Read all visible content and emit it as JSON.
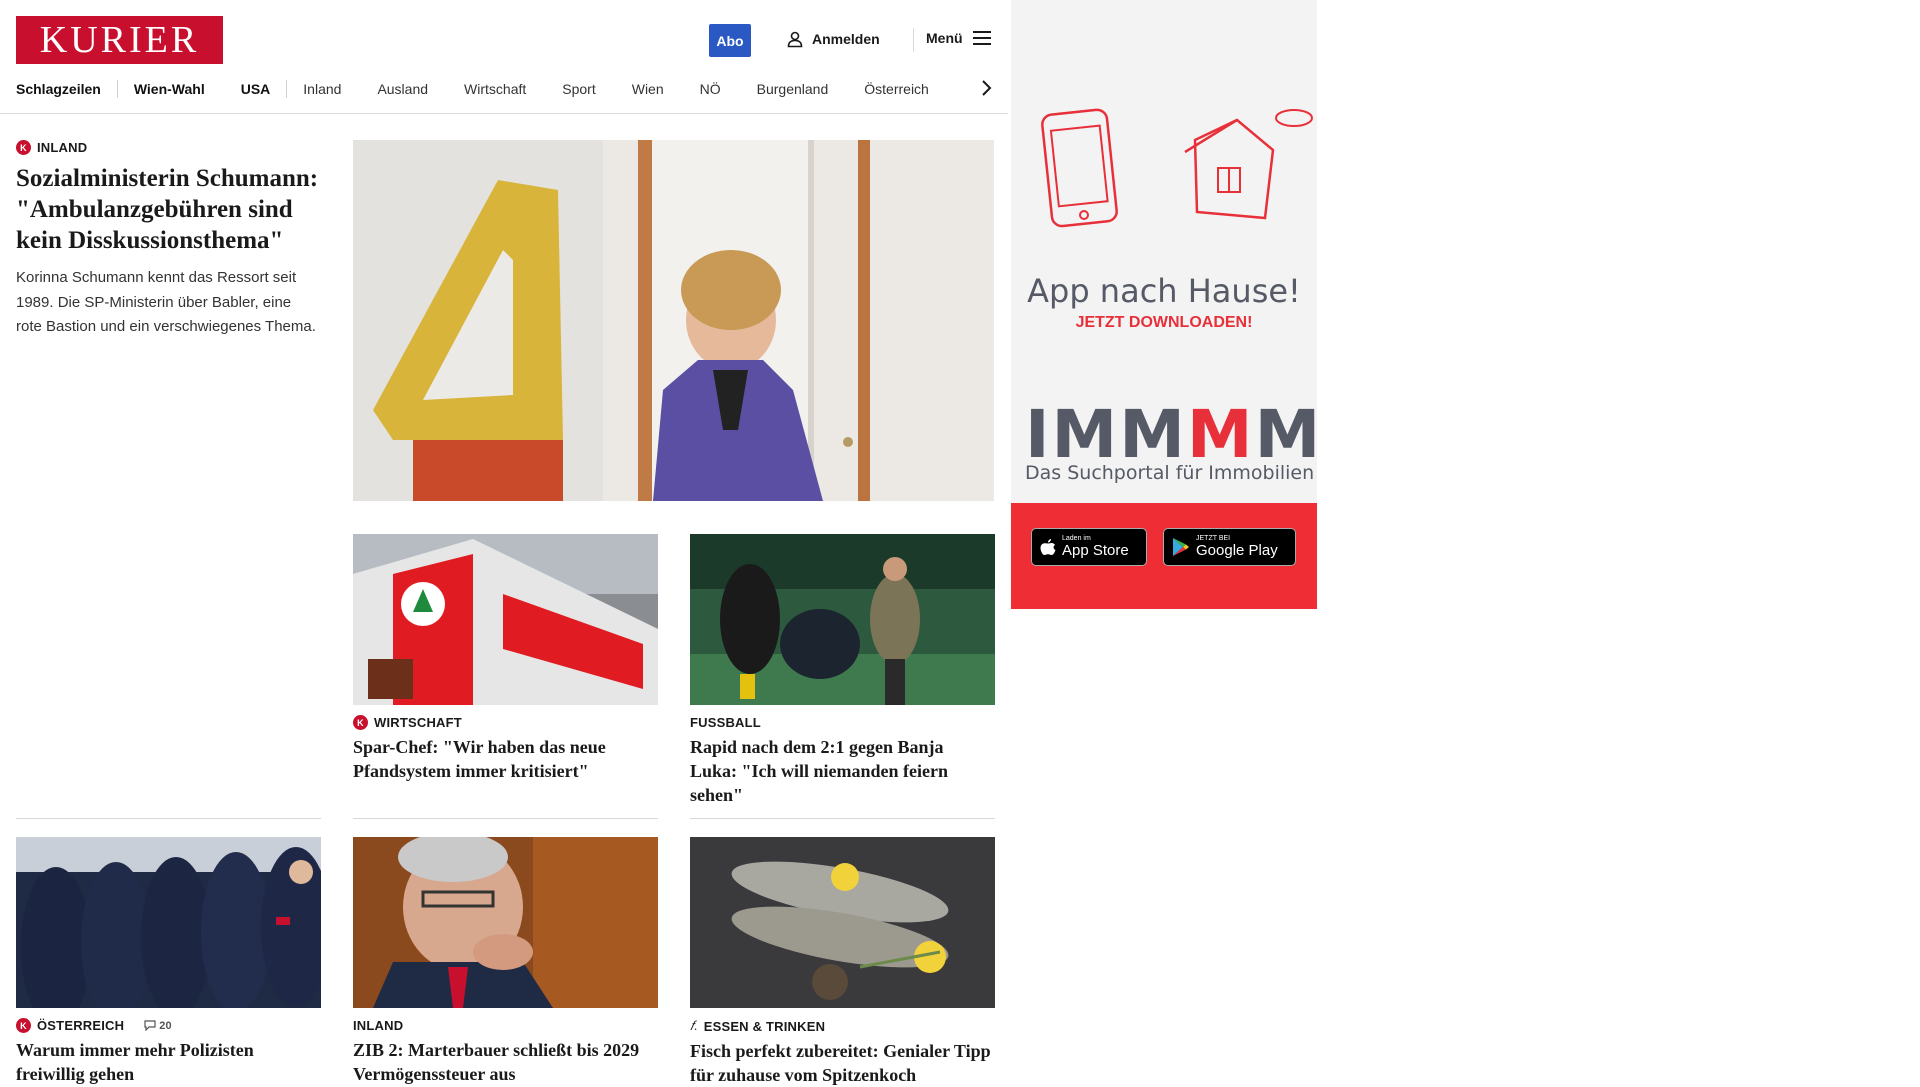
{
  "header": {
    "logo_text": "KURIER",
    "abo_label": "Abo",
    "login_label": "Anmelden",
    "menu_label": "Menü",
    "brand_color": "#c8102e",
    "abo_color": "#2b59c3"
  },
  "nav": {
    "items": [
      "Schlagzeilen",
      "Wien-Wahl",
      "USA",
      "Inland",
      "Ausland",
      "Wirtschaft",
      "Sport",
      "Wien",
      "NÖ",
      "Burgenland",
      "Österreich"
    ]
  },
  "lead": {
    "kicker": "INLAND",
    "headline": "Sozialministerin Schumann: \"Ambulanzgebühren sind kein Disskussionsthema\"",
    "teaser": "Korinna Schumann kennt das Ressort seit 1989. Die SP-Ministerin über Babler, eine rote Bastion und ein verschwiegenes Thema."
  },
  "cards": [
    {
      "kicker": "WIRTSCHAFT",
      "headline": "Spar-Chef: \"Wir haben das neue Pfandsystem immer kritisiert\""
    },
    {
      "kicker": "FUSSBALL",
      "headline": "Rapid nach dem 2:1 gegen Banja Luka: \"Ich will niemanden feiern sehen\""
    },
    {
      "kicker": "ÖSTERREICH",
      "headline": "Warum immer mehr Polizisten freiwillig gehen",
      "comments": "20"
    },
    {
      "kicker": "INLAND",
      "headline": "ZIB 2: Marterbauer schließt bis 2029 Vermögenssteuer aus"
    },
    {
      "kicker": "ESSEN & TRINKEN",
      "headline": "Fisch perfekt zubereitet: Genialer Tipp für zuhause vom Spitzenkoch"
    }
  ],
  "ad": {
    "title": "App nach Hause!",
    "cta": "JETZT DOWNLOADEN!",
    "brand_a": "IMM",
    "brand_b": "M",
    "brand_c": "MO",
    "brand_sub": "Das Suchportal für Immobilien",
    "appstore_small": "Laden im",
    "appstore_big": "App Store",
    "googleplay_small": "JETZT BEI",
    "googleplay_big": "Google Play",
    "accent_color": "#ee2d35"
  }
}
